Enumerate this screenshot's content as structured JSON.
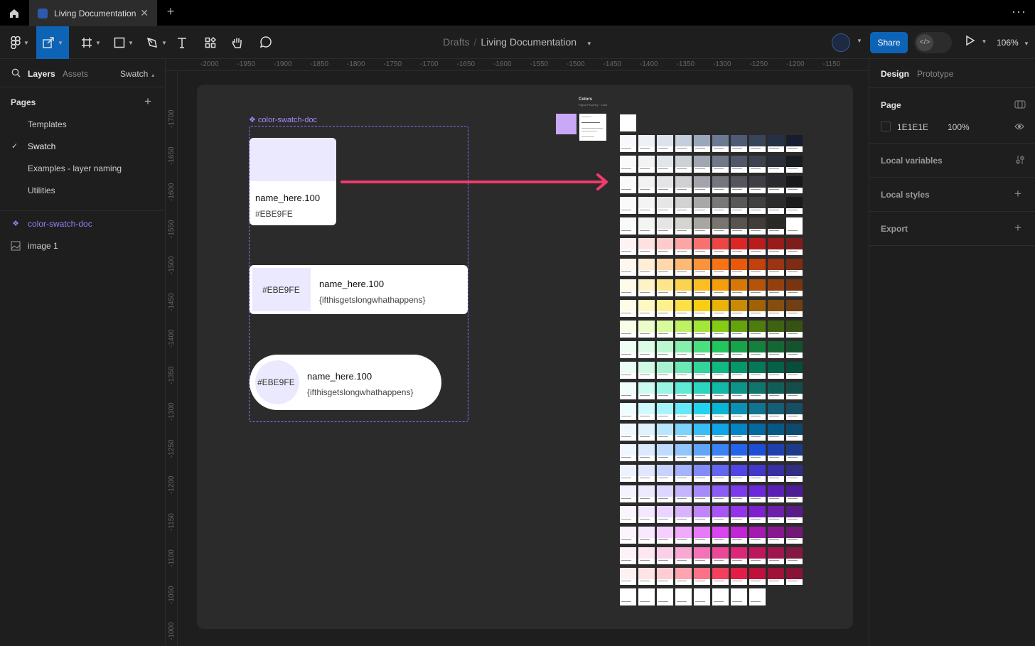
{
  "titlebar": {
    "file_tab": "Living Documentation",
    "close": "✕",
    "new_tab": "+",
    "more": "···"
  },
  "toolbar": {
    "breadcrumb_drafts": "Drafts",
    "breadcrumb_sep": "/",
    "breadcrumb_file": "Living Documentation",
    "share_label": "Share",
    "zoom": "106%"
  },
  "left_panel": {
    "tabs": {
      "layers": "Layers",
      "assets": "Assets",
      "page_dropdown": "Swatch"
    },
    "pages_header": "Pages",
    "add_page": "+",
    "pages": [
      "Templates",
      "Swatch",
      "Examples - layer naming",
      "Utilities"
    ],
    "current_page_check": "✓",
    "layers": [
      {
        "name": "color-swatch-doc",
        "icon": "component-icon",
        "color": "#9a7cf0"
      },
      {
        "name": "image 1",
        "icon": "image-icon",
        "color": "#cccccc"
      }
    ]
  },
  "ruler": {
    "top_ticks": [
      "-2000",
      "-1950",
      "-1900",
      "-1850",
      "-1800",
      "-1750",
      "-1700",
      "-1650",
      "-1600",
      "-1550",
      "-1500",
      "-1450",
      "-1400",
      "-1350",
      "-1300",
      "-1250",
      "-1200",
      "-1150"
    ],
    "left_ticks": [
      "-1700",
      "-1650",
      "-1600",
      "-1550",
      "-1500",
      "-1450",
      "-1400",
      "-1350",
      "-1300",
      "-1250",
      "-1200",
      "-1150",
      "-1100",
      "-1050",
      "-1000"
    ]
  },
  "canvas": {
    "component_label": "❖ color-swatch-doc",
    "swatch_color": "#EBE9FE",
    "accent_color": "#9A6CFF",
    "arrow_color": "#F23A6E",
    "card1": {
      "name": "name_here.100",
      "hex": "#EBE9FE"
    },
    "card2": {
      "hex": "#EBE9FE",
      "name": "name_here.100",
      "token": "{ifthisgetslongwhathappens}"
    },
    "card3": {
      "hex": "#EBE9FE",
      "name": "name_here.100",
      "token": "{ifthisgetslongwhathappens}"
    },
    "colors_title": "Colors",
    "colors_subtitle": "Figma Property · Color",
    "palette_rows": [
      [
        "#f8f9fc",
        "#eef1f6",
        "#dde3ec",
        "#c5cedb",
        "#9aa6ba",
        "#6b7a93",
        "#4d5b74",
        "#38445a",
        "#263045",
        "#161d30"
      ],
      [
        "#f9fafb",
        "#f1f3f5",
        "#e2e5e9",
        "#cdd1d8",
        "#a1a7b2",
        "#71788a",
        "#525868",
        "#3d4250",
        "#2a2e39",
        "#181b22"
      ],
      [
        "#fafafa",
        "#f2f2f3",
        "#e4e4e7",
        "#cfcfd4",
        "#a3a3ab",
        "#75757e",
        "#55555d",
        "#3e3e44",
        "#2a2a2e",
        "#18181b"
      ],
      [
        "#fafafa",
        "#f4f4f4",
        "#e6e6e6",
        "#d2d2d2",
        "#a8a8a8",
        "#787878",
        "#585858",
        "#404040",
        "#2b2b2b",
        "#1a1a1a"
      ],
      [
        "#fafaf9",
        "#f4f4f3",
        "#e5e5e3",
        "#d5d4d1",
        "#a8a6a1",
        "#78756f",
        "#57544f",
        "#403d39",
        "#2b2926",
        "#ffffff"
      ],
      [
        "#fef2f2",
        "#fee2e2",
        "#fecaca",
        "#fca5a5",
        "#f87171",
        "#ef4444",
        "#dc2626",
        "#b91c1c",
        "#991b1b",
        "#7f1d1d"
      ],
      [
        "#fff7ed",
        "#ffedd5",
        "#fed7aa",
        "#fdba74",
        "#fb923c",
        "#f97316",
        "#ea580c",
        "#c2410c",
        "#9a3412",
        "#7c2d12"
      ],
      [
        "#fffbeb",
        "#fef3c7",
        "#fde68a",
        "#fcd34d",
        "#fbbf24",
        "#f59e0b",
        "#d97706",
        "#b45309",
        "#92400e",
        "#78350f"
      ],
      [
        "#fefce8",
        "#fef9c3",
        "#fef08a",
        "#fde047",
        "#facc15",
        "#eab308",
        "#ca8a04",
        "#a16207",
        "#854d0e",
        "#713f12"
      ],
      [
        "#f7fee7",
        "#ecfccb",
        "#d9f99d",
        "#bef264",
        "#a3e635",
        "#84cc16",
        "#65a30d",
        "#4d7c0f",
        "#3f6212",
        "#365314"
      ],
      [
        "#f0fdf4",
        "#dcfce7",
        "#bbf7d0",
        "#86efac",
        "#4ade80",
        "#22c55e",
        "#16a34a",
        "#15803d",
        "#166534",
        "#14532d"
      ],
      [
        "#ecfdf5",
        "#d1fae5",
        "#a7f3d0",
        "#6ee7b7",
        "#34d399",
        "#10b981",
        "#059669",
        "#047857",
        "#065f46",
        "#064e3b"
      ],
      [
        "#f0fdfa",
        "#ccfbf1",
        "#99f6e4",
        "#5eead4",
        "#2dd4bf",
        "#14b8a6",
        "#0d9488",
        "#0f766e",
        "#115e59",
        "#134e4a"
      ],
      [
        "#ecfeff",
        "#cffafe",
        "#a5f3fc",
        "#67e8f9",
        "#22d3ee",
        "#06b6d4",
        "#0891b2",
        "#0e7490",
        "#155e75",
        "#164e63"
      ],
      [
        "#f0f9ff",
        "#e0f2fe",
        "#bae6fd",
        "#7dd3fc",
        "#38bdf8",
        "#0ea5e9",
        "#0284c7",
        "#0369a1",
        "#075985",
        "#0c4a6e"
      ],
      [
        "#eff6ff",
        "#dbeafe",
        "#bfdbfe",
        "#93c5fd",
        "#60a5fa",
        "#3b82f6",
        "#2563eb",
        "#1d4ed8",
        "#1e40af",
        "#1e3a8a"
      ],
      [
        "#eef2ff",
        "#e0e7ff",
        "#c7d2fe",
        "#a5b4fc",
        "#818cf8",
        "#6366f1",
        "#4f46e5",
        "#4338ca",
        "#3730a3",
        "#312e81"
      ],
      [
        "#f5f3ff",
        "#ede9fe",
        "#ddd6fe",
        "#c4b5fd",
        "#a78bfa",
        "#8b5cf6",
        "#7c3aed",
        "#6d28d9",
        "#5b21b6",
        "#4c1d95"
      ],
      [
        "#faf5ff",
        "#f3e8ff",
        "#e9d5ff",
        "#d8b4fe",
        "#c084fc",
        "#a855f7",
        "#9333ea",
        "#7e22ce",
        "#6b21a8",
        "#581c87"
      ],
      [
        "#fdf4ff",
        "#fae8ff",
        "#f5d0fe",
        "#f0abfc",
        "#e879f9",
        "#d946ef",
        "#c026d3",
        "#a21caf",
        "#86198f",
        "#701a75"
      ],
      [
        "#fdf2f8",
        "#fce7f3",
        "#fbcfe8",
        "#f9a8d4",
        "#f472b6",
        "#ec4899",
        "#db2777",
        "#be185d",
        "#9d174d",
        "#831843"
      ],
      [
        "#fff1f2",
        "#ffe4e6",
        "#fecdd3",
        "#fda4af",
        "#fb7185",
        "#f43f5e",
        "#e11d48",
        "#be123c",
        "#9f1239",
        "#881337"
      ],
      [
        "#ffffff",
        "#ffffff",
        "#ffffff",
        "#ffffff",
        "#ffffff",
        "#ffffff",
        "#ffffff",
        "#ffffff"
      ]
    ]
  },
  "help": "?",
  "right_panel": {
    "tabs": {
      "design": "Design",
      "prototype": "Prototype"
    },
    "page_section": "Page",
    "bg_hex": "1E1E1E",
    "bg_opacity": "100%",
    "local_variables": "Local variables",
    "local_styles": "Local styles",
    "export": "Export",
    "add": "+"
  }
}
